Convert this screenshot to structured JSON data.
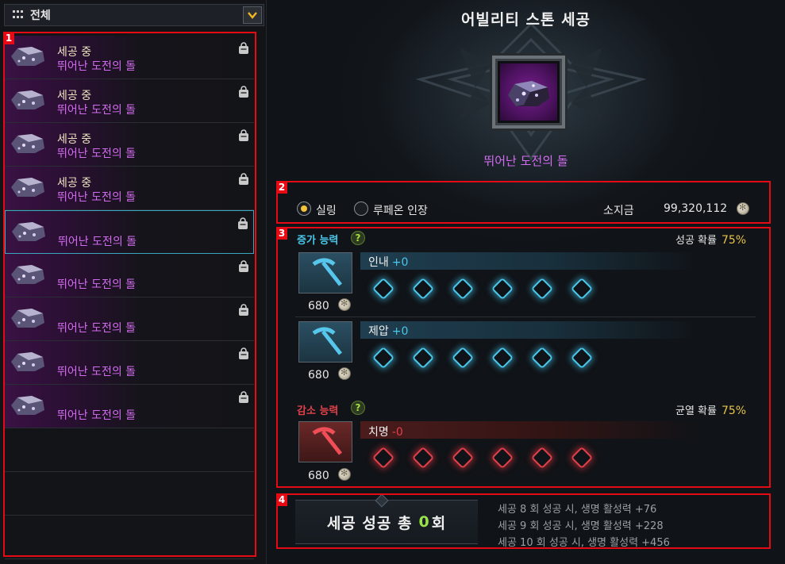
{
  "filter": {
    "label": "전체"
  },
  "list": {
    "items": [
      {
        "status": "세공 중",
        "name": "뛰어난 도전의 돌"
      },
      {
        "status": "세공 중",
        "name": "뛰어난 도전의 돌"
      },
      {
        "status": "세공 중",
        "name": "뛰어난 도전의 돌"
      },
      {
        "status": "세공 중",
        "name": "뛰어난 도전의 돌"
      },
      {
        "status": "",
        "name": "뛰어난 도전의 돌"
      },
      {
        "status": "",
        "name": "뛰어난 도전의 돌"
      },
      {
        "status": "",
        "name": "뛰어난 도전의 돌"
      },
      {
        "status": "",
        "name": "뛰어난 도전의 돌"
      },
      {
        "status": "",
        "name": "뛰어난 도전의 돌"
      }
    ],
    "selected_index": 4
  },
  "header": {
    "title": "어빌리티 스톤 세공",
    "item_name": "뛰어난 도전의 돌"
  },
  "currency": {
    "option1": "실링",
    "option2": "루페온 인장",
    "selected": "실링",
    "held_label": "소지금",
    "held_value": "99,320,112"
  },
  "increase": {
    "header": "증가 능력",
    "help": "?",
    "rate_label": "성공 확률",
    "rate_value": "75%",
    "abilities": [
      {
        "name": "인내",
        "value": "+0",
        "cost": "680"
      },
      {
        "name": "제압",
        "value": "+0",
        "cost": "680"
      }
    ]
  },
  "decrease": {
    "header": "감소 능력",
    "help": "?",
    "rate_label": "균열 확률",
    "rate_value": "75%",
    "abilities": [
      {
        "name": "치명",
        "value": "-0",
        "cost": "680"
      }
    ]
  },
  "summary": {
    "prefix": "세공 성공 총",
    "count": "0",
    "suffix": "회",
    "bonuses": [
      "세공 8 회 성공 시, 생명 활성력 +76",
      "세공 9 회 성공 시, 생명 활성력 +228",
      "세공 10 회 성공 시, 생명 활성력 +456"
    ]
  },
  "badges": [
    "1",
    "2",
    "3",
    "4"
  ],
  "colors": {
    "highlight_red": "#e50a14",
    "increase_accent": "#49c7ea",
    "decrease_accent": "#e0404a",
    "rate": "#e9c44a",
    "item_purple": "#d36cf0",
    "success_count": "#9be34a"
  }
}
